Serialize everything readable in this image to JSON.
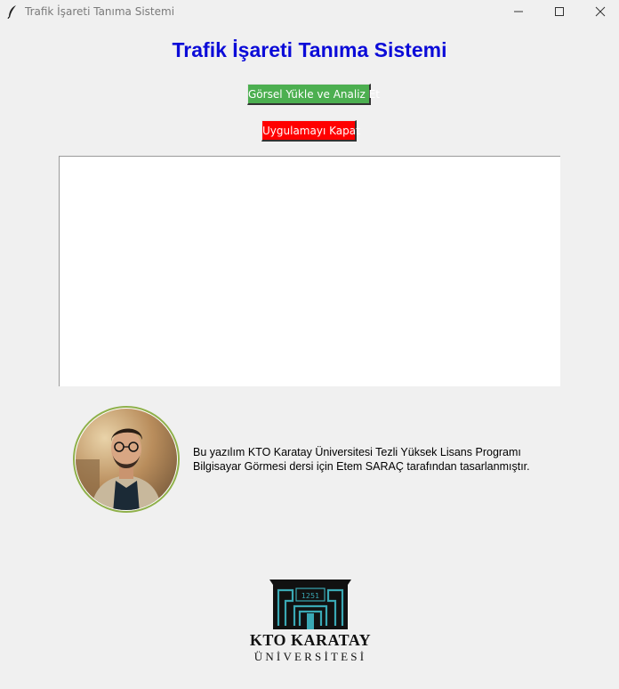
{
  "window": {
    "title": "Trafik İşareti Tanıma Sistemi",
    "app_icon": "feather-icon",
    "controls": [
      "minimize-icon",
      "maximize-icon",
      "close-icon"
    ]
  },
  "main": {
    "heading": "Trafik İşareti Tanıma Sistemi",
    "heading_color": "#0b0bd8",
    "upload_button": {
      "label": "Görsel Yükle ve Analiz Et",
      "color": "#4caf50"
    },
    "close_button": {
      "label": "Uygulamayı Kapat",
      "color": "#ff0000"
    }
  },
  "credit": {
    "line1": "Bu yazılım KTO Karatay Üniversitesi Tezli Yüksek Lisans Programı",
    "line2": "Bilgisayar Görmesi dersi için Etem SARAÇ tarafından tasarlanmıştır."
  },
  "logo": {
    "badge_text": "1251",
    "name_line1": "KTO KARATAY",
    "name_line2": "ÜNİVERSİTESİ",
    "accent_color": "#3aa8b4"
  }
}
